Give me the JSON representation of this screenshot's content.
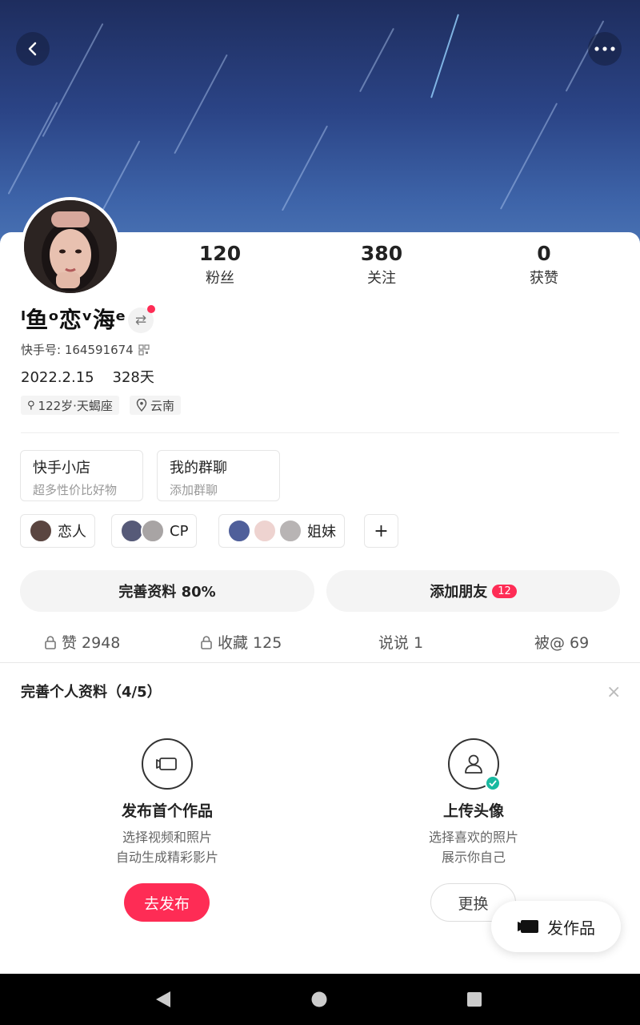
{
  "profile": {
    "nickname": "ˡ鱼ᵒ恋ᵛ海ᵉ",
    "kwai_id": "快手号: 164591674",
    "bio": "2022.2.15    328天",
    "tags": [
      "122岁·天蝎座",
      "云南"
    ]
  },
  "stats": [
    {
      "num": "120",
      "label": "粉丝"
    },
    {
      "num": "380",
      "label": "关注"
    },
    {
      "num": "0",
      "label": "获赞"
    }
  ],
  "features": [
    {
      "title": "快手小店",
      "subtitle": "超多性价比好物"
    },
    {
      "title": "我的群聊",
      "subtitle": "添加群聊"
    }
  ],
  "relations": [
    {
      "label": "恋人"
    },
    {
      "label": "CP"
    },
    {
      "label": "姐妹"
    }
  ],
  "relation_add": "+",
  "actions": {
    "complete_profile": "完善资料 80%",
    "add_friends": "添加朋友",
    "add_friends_badge": "12"
  },
  "tabs": [
    {
      "label": "赞 2948",
      "locked": true
    },
    {
      "label": "收藏 125",
      "locked": true
    },
    {
      "label": "说说 1",
      "locked": false
    },
    {
      "label": "被@ 69",
      "locked": false
    }
  ],
  "complete_section": {
    "title": "完善个人资料（4/5）",
    "close": "×",
    "tasks": [
      {
        "title": "发布首个作品",
        "line1": "选择视频和照片",
        "line2": "自动生成精彩影片",
        "button": "去发布",
        "icon": "camera-icon"
      },
      {
        "title": "上传头像",
        "line1": "选择喜欢的照片",
        "line2": "展示你自己",
        "button": "更换",
        "icon": "user-icon"
      }
    ]
  },
  "fab_label": "发作品",
  "colors": {
    "accent": "#fe2c55",
    "check": "#19b9a0"
  }
}
